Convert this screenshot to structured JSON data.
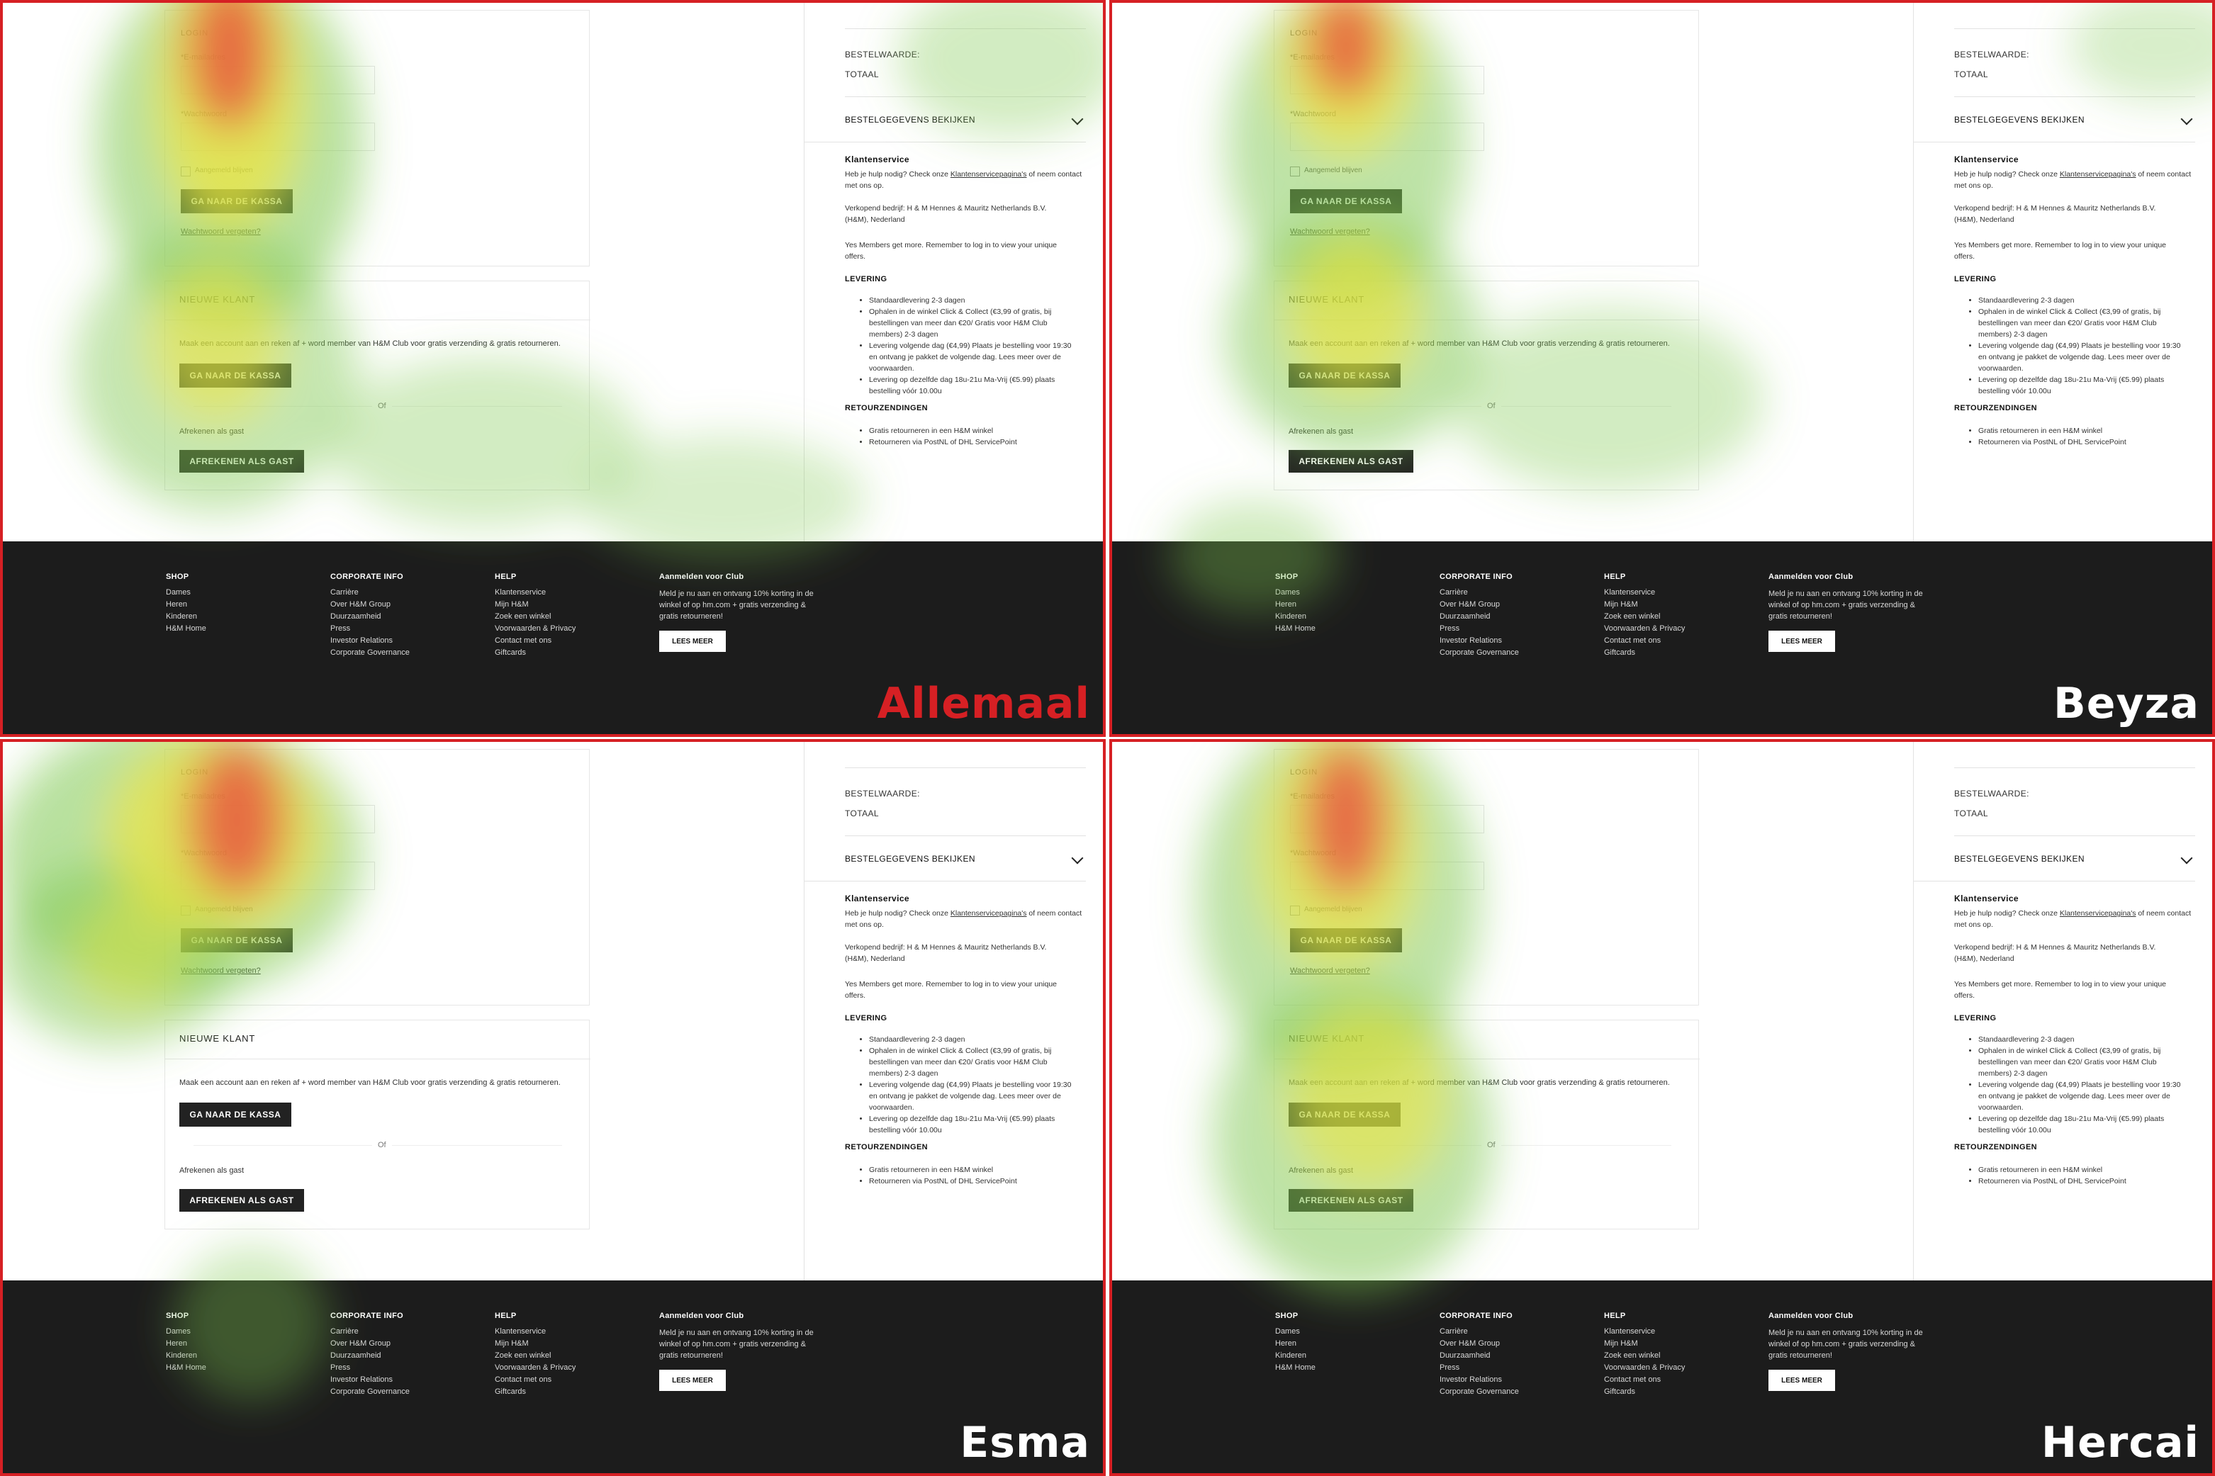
{
  "login": {
    "title": "LOGIN",
    "email_label": "*E-mailadres",
    "password_label": "*Wachtwoord",
    "remember_label": "Aangemeld blijven",
    "submit_button": "GA NAAR DE KASSA",
    "forgot_link": "Wachtwoord vergeten?"
  },
  "new_customer": {
    "title": "NIEUWE KLANT",
    "description": "Maak een account aan en reken af + word member van H&M Club voor gratis verzending & gratis retourneren.",
    "button": "GA NAAR DE KASSA",
    "or_text": "Of",
    "guest_label": "Afrekenen als gast",
    "guest_button": "AFREKENEN ALS GAST"
  },
  "sidebar": {
    "order_value": "BESTELWAARDE:",
    "total": "TOTAAL",
    "order_details": "BESTELGEGEVENS BEKIJKEN",
    "service_title": "Klantenservice",
    "service_text_1": "Heb je hulp nodig? Check onze ",
    "service_link": "Klantenservicepagina's",
    "service_text_2": " of neem contact met ons op.",
    "seller": "Verkopend bedrijf: H & M Hennes & Mauritz Netherlands B.V. (H&M), Nederland",
    "members": "Yes Members get more. Remember to log in to view your unique offers.",
    "delivery_title": "LEVERING",
    "delivery_items": [
      "Standaardlevering 2-3 dagen",
      "Ophalen in de winkel Click & Collect (€3,99 of gratis, bij bestellingen van meer dan €20/ Gratis voor H&M Club members) 2-3 dagen",
      "Levering volgende dag (€4,99) Plaats je bestelling voor 19:30 en ontvang je pakket de volgende dag. Lees meer over de voorwaarden.",
      "Levering op dezelfde dag 18u-21u Ma-Vrij (€5.99) plaats bestelling vóór 10.00u"
    ],
    "returns_title": "RETOURZENDINGEN",
    "returns_items": [
      "Gratis retourneren in een H&M winkel",
      "Retourneren via PostNL of DHL ServicePoint"
    ]
  },
  "footer": {
    "shop_title": "SHOP",
    "shop_items": [
      "Dames",
      "Heren",
      "Kinderen",
      "H&M Home"
    ],
    "corp_title": "CORPORATE INFO",
    "corp_items": [
      "Carrière",
      "Over H&M Group",
      "Duurzaamheid",
      "Press",
      "Investor Relations",
      "Corporate Governance"
    ],
    "help_title": "HELP",
    "help_items": [
      "Klantenservice",
      "Mijn H&M",
      "Zoek een winkel",
      "Voorwaarden & Privacy",
      "Contact met ons",
      "Giftcards"
    ],
    "club_title": "Aanmelden voor Club",
    "club_text": "Meld je nu aan en ontvang 10% korting in de winkel of op hm.com + gratis verzending & gratis retourneren!",
    "club_button": "LEES MEER"
  },
  "panels": [
    {
      "name": "Allemaal",
      "name_color": "#d62024"
    },
    {
      "name": "Beyza",
      "name_color": "#ffffff"
    },
    {
      "name": "Esma",
      "name_color": "#ffffff"
    },
    {
      "name": "Hercai",
      "name_color": "#ffffff"
    }
  ],
  "colors": {
    "panel_border": "#d62024",
    "footer_bg": "#1c1c1c",
    "button_bg": "#222222",
    "heat_low": "#7ec850",
    "heat_mid": "#f2e53a",
    "heat_high": "#e8473b"
  }
}
